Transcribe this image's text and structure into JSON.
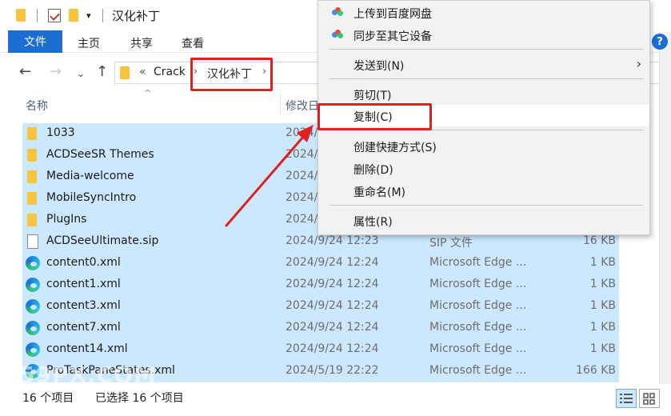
{
  "window": {
    "title": "汉化补丁"
  },
  "ribbon": {
    "file": "文件",
    "home": "主页",
    "share": "共享",
    "view": "查看",
    "help": "?"
  },
  "address": {
    "overflow": "«",
    "crumbs": [
      "Crack",
      "汉化补丁"
    ]
  },
  "columns": {
    "name": "名称",
    "date": "修改日"
  },
  "files": [
    {
      "name": "1033",
      "date": "2024/",
      "type": "",
      "size": "",
      "icon": "folder-icon"
    },
    {
      "name": "ACDSeeSR Themes",
      "date": "2024/",
      "type": "",
      "size": "",
      "icon": "folder-icon"
    },
    {
      "name": "Media-welcome",
      "date": "2024/",
      "type": "",
      "size": "",
      "icon": "folder-icon"
    },
    {
      "name": "MobileSyncIntro",
      "date": "2024/",
      "type": "",
      "size": "",
      "icon": "folder-icon"
    },
    {
      "name": "PlugIns",
      "date": "2024/",
      "type": "",
      "size": "",
      "icon": "folder-icon"
    },
    {
      "name": "ACDSeeUltimate.sip",
      "date": "2024/9/24 12:23",
      "type": "SIP 文件",
      "size": "16 KB",
      "icon": "file-icon"
    },
    {
      "name": "content0.xml",
      "date": "2024/9/24 12:24",
      "type": "Microsoft Edge ...",
      "size": "1 KB",
      "icon": "edge-icon"
    },
    {
      "name": "content1.xml",
      "date": "2024/9/24 12:24",
      "type": "Microsoft Edge ...",
      "size": "1 KB",
      "icon": "edge-icon"
    },
    {
      "name": "content3.xml",
      "date": "2024/9/24 12:24",
      "type": "Microsoft Edge ...",
      "size": "1 KB",
      "icon": "edge-icon"
    },
    {
      "name": "content7.xml",
      "date": "2024/9/24 12:24",
      "type": "Microsoft Edge ...",
      "size": "1 KB",
      "icon": "edge-icon"
    },
    {
      "name": "content14.xml",
      "date": "2024/9/24 12:24",
      "type": "Microsoft Edge ...",
      "size": "1 KB",
      "icon": "edge-icon"
    },
    {
      "name": "ProTaskPaneStates.xml",
      "date": "2024/5/19 22:22",
      "type": "Microsoft Edge ...",
      "size": "166 KB",
      "icon": "edge-icon"
    }
  ],
  "context_menu": {
    "upload_baidu": "上传到百度网盘",
    "sync_device": "同步至其它设备",
    "send_to": "发送到(N)",
    "cut": "剪切(T)",
    "copy": "复制(C)",
    "create_shortcut": "创建快捷方式(S)",
    "delete": "删除(D)",
    "rename": "重命名(M)",
    "properties": "属性(R)"
  },
  "status": {
    "count": "16 个项目",
    "selected": "已选择 16 个项目"
  },
  "watermark": "59PX.COM",
  "colors": {
    "accent": "#1a6dd3",
    "selection": "#cce8ff",
    "highlight_box": "#e02020"
  }
}
